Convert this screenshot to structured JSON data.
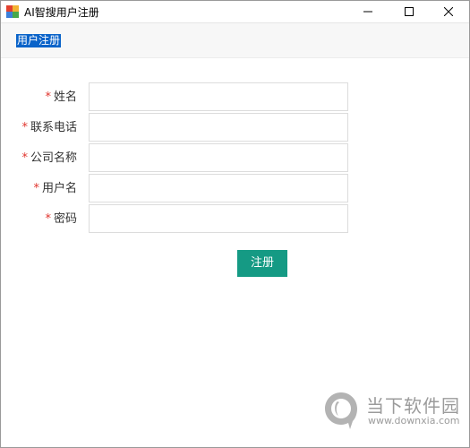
{
  "window": {
    "title": "AI智搜用户注册",
    "controls": [
      "minimize-icon",
      "maximize-icon",
      "close-icon"
    ]
  },
  "tab": {
    "label": "用户注册"
  },
  "form": {
    "required_mark": "*",
    "fields": [
      {
        "label": "姓名",
        "value": ""
      },
      {
        "label": "联系电话",
        "value": ""
      },
      {
        "label": "公司名称",
        "value": ""
      },
      {
        "label": "用户名",
        "value": ""
      },
      {
        "label": "密码",
        "value": ""
      }
    ],
    "submit_label": "注册"
  },
  "watermark": {
    "name": "当下软件园",
    "url": "www.downxia.com"
  },
  "colors": {
    "accent": "#159a84",
    "required": "#e0342c",
    "tab_highlight": "#0a63c9"
  }
}
